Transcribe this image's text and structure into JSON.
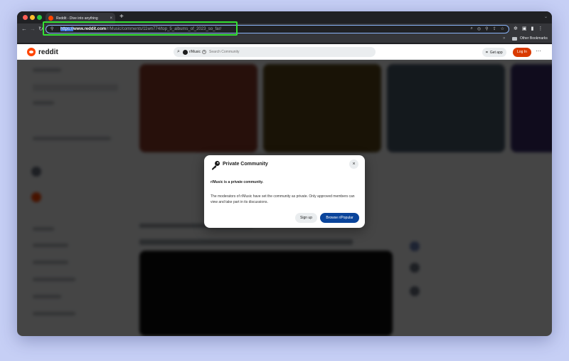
{
  "browser": {
    "tab_title": "Reddit - Dive into anything",
    "tab_close": "×",
    "new_tab": "+",
    "url_scheme": "https://",
    "url_domain": "www.reddit.com",
    "url_path": "/r/Music/comments/11wn774/top_5_albums_of_2023_so_far/",
    "bookmarks_label": "Other Bookmarks"
  },
  "header": {
    "logo_text": "reddit",
    "community_chip": "r/Music",
    "search_placeholder": "Search Community",
    "get_app_label": "Get app",
    "login_label": "Log In",
    "more_label": "···"
  },
  "modal": {
    "title": "Private Community",
    "close_label": "×",
    "subtitle": "r/Music is a private community.",
    "body": "The moderators of r/Music have set the community as private. Only approved members can view and take part in its discussions.",
    "signup_label": "Sign up",
    "browse_label": "Browse r/Popular"
  },
  "colors": {
    "highlight_box": "#34e234",
    "reddit_orange": "#ff4500",
    "login_button": "#d93a00",
    "browse_button": "#0a449b"
  }
}
